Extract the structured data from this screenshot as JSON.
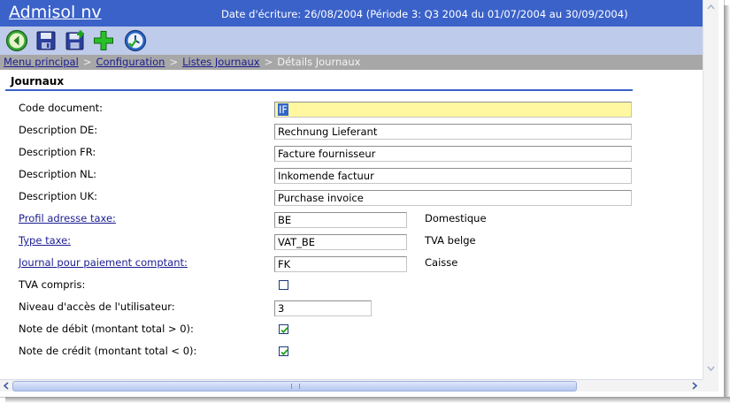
{
  "header": {
    "app_title": "Admisol nv",
    "date_info": "Date d'écriture: 26/08/2004 (Période 3: Q3 2004 du 01/07/2004 au 30/09/2004)"
  },
  "toolbar": {
    "buttons": [
      {
        "icon": "back-arrow-icon",
        "color": "#2a9a2a"
      },
      {
        "icon": "save-icon",
        "color": "#2b3f9c"
      },
      {
        "icon": "save-new-icon",
        "color": "#2b3f9c"
      },
      {
        "icon": "add-icon",
        "color": "#18a818"
      },
      {
        "icon": "clock-icon",
        "color": "#2b66c4"
      }
    ]
  },
  "breadcrumb": {
    "items": [
      "Menu principal",
      "Configuration",
      "Listes Journaux"
    ],
    "current": "Détails Journaux",
    "separator": ">"
  },
  "section": {
    "title": "Journaux"
  },
  "form": {
    "code_document": {
      "label": "Code document:",
      "value": "IF"
    },
    "desc_de": {
      "label": "Description DE:",
      "value": "Rechnung Lieferant"
    },
    "desc_fr": {
      "label": "Description FR:",
      "value": "Facture fournisseur"
    },
    "desc_nl": {
      "label": "Description NL:",
      "value": "Inkomende factuur"
    },
    "desc_uk": {
      "label": "Description UK:",
      "value": "Purchase invoice"
    },
    "tax_profile": {
      "label": "Profil adresse taxe:",
      "value": "BE",
      "description": "Domestique"
    },
    "tax_type": {
      "label": "Type taxe:",
      "value": "VAT_BE",
      "description": "TVA belge"
    },
    "cash_journal": {
      "label": "Journal pour paiement comptant:",
      "value": "FK",
      "description": "Caisse"
    },
    "vat_included": {
      "label": "TVA compris:",
      "checked": false
    },
    "access_level": {
      "label": "Niveau d'accès de l'utilisateur:",
      "value": "3"
    },
    "debit_note": {
      "label": "Note de débit (montant total > 0):",
      "checked": true
    },
    "credit_note": {
      "label": "Note de crédit (montant total < 0):",
      "checked": true
    }
  },
  "colors": {
    "title_bar": "#3b62c9",
    "toolbar": "#bfcbea",
    "breadcrumb_bar": "#a7a7a7",
    "link": "#1b1d8f",
    "highlight_field": "#fff8a1"
  }
}
